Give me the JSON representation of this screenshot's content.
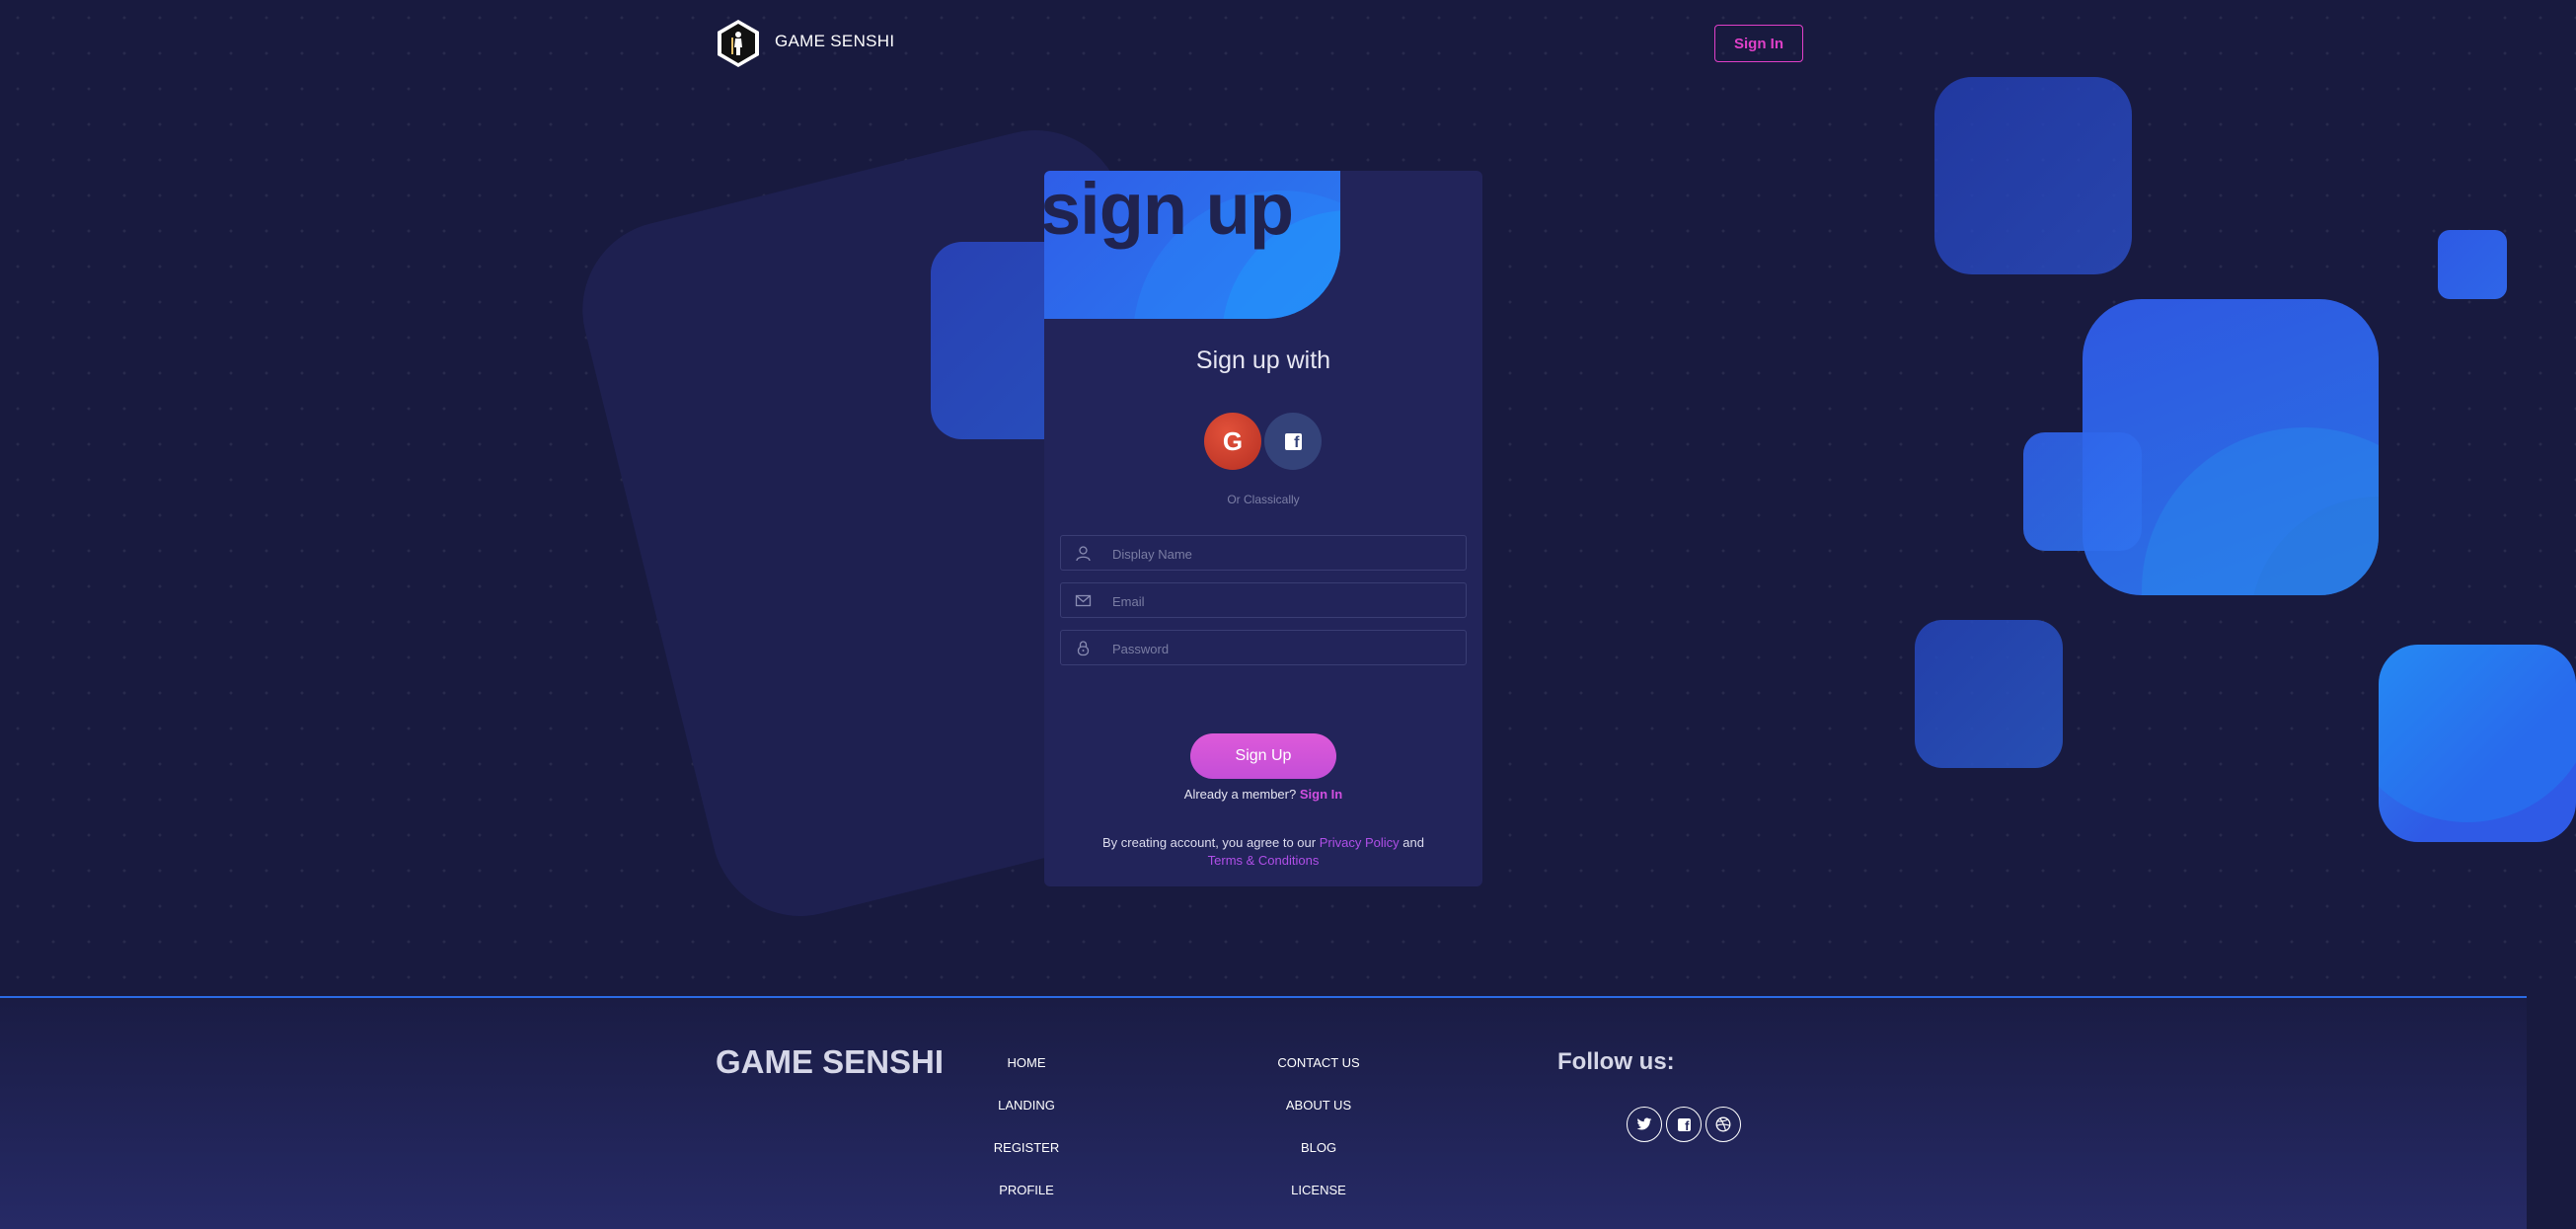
{
  "header": {
    "brand": "GAME SENSHI",
    "signin_label": "Sign In"
  },
  "card": {
    "banner_text": "sign up",
    "signup_with": "Sign up with",
    "google_label": "G",
    "or_text": "Or Classically",
    "fields": {
      "display_name_placeholder": "Display Name",
      "email_placeholder": "Email",
      "password_placeholder": "Password"
    },
    "signup_button": "Sign Up",
    "member_text": "Already a member?",
    "member_link": "Sign In",
    "terms_prefix": "By creating account, you agree to our",
    "privacy_link": "Privacy Policy",
    "terms_and": "and",
    "terms_link": "Terms & Conditions"
  },
  "footer": {
    "brand": "GAME SENSHI",
    "links_col1": [
      "HOME",
      "LANDING",
      "REGISTER",
      "PROFILE"
    ],
    "links_col2": [
      "CONTACT US",
      "ABOUT US",
      "BLOG",
      "LICENSE"
    ],
    "follow": "Follow us:",
    "social_icons": [
      "twitter-icon",
      "facebook-icon",
      "dribbble-icon"
    ]
  },
  "colors": {
    "background": "#181a3f",
    "card": "#22245a",
    "accent_pink": "#e040c8",
    "accent_blue": "#2a6be6"
  }
}
